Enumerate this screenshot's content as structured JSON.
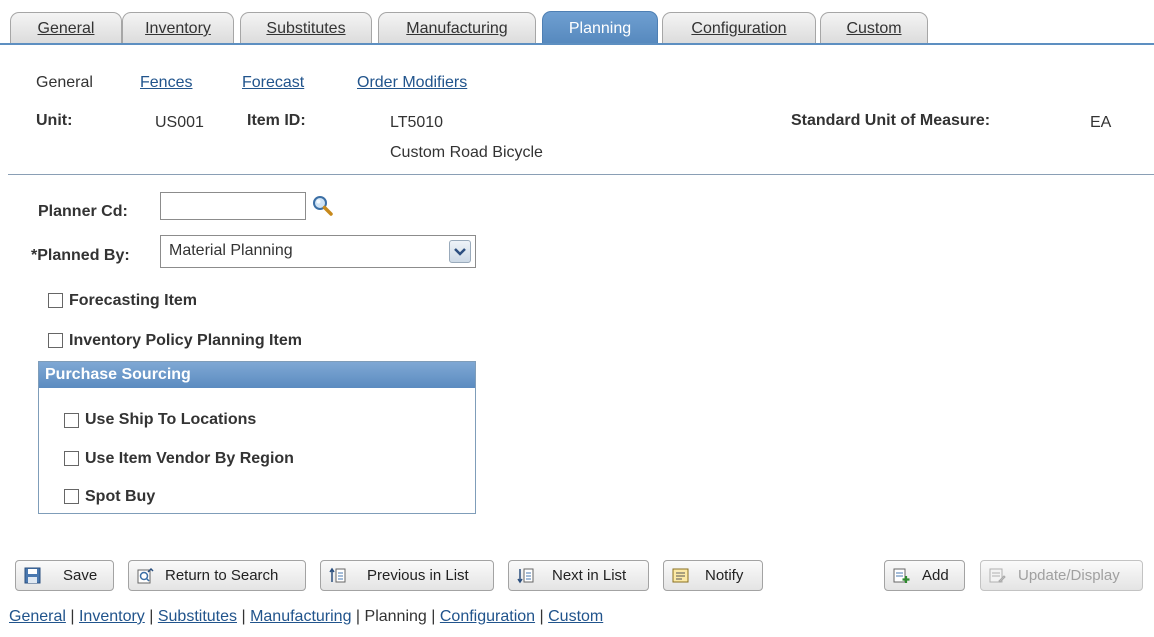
{
  "tabs": [
    {
      "label": "General",
      "active": false
    },
    {
      "label": "Inventory",
      "active": false
    },
    {
      "label": "Substitutes",
      "active": false
    },
    {
      "label": "Manufacturing",
      "active": false
    },
    {
      "label": "Planning",
      "active": true
    },
    {
      "label": "Configuration",
      "active": false
    },
    {
      "label": "Custom",
      "active": false
    }
  ],
  "subnav": {
    "current": "General",
    "links": [
      "Fences",
      "Forecast",
      "Order Modifiers"
    ]
  },
  "header": {
    "unit_label": "Unit:",
    "unit_value": "US001",
    "item_label": "Item ID:",
    "item_value": "LT5010",
    "item_desc": "Custom Road Bicycle",
    "uom_label": "Standard Unit of Measure:",
    "uom_value": "EA"
  },
  "form": {
    "planner_label": "Planner Cd:",
    "planner_value": "",
    "planned_by_label": "*Planned By:",
    "planned_by_value": "Material Planning",
    "forecasting_label": "Forecasting Item",
    "inventory_policy_label": "Inventory Policy Planning Item"
  },
  "purchase_sourcing": {
    "title": "Purchase Sourcing",
    "use_ship_to": "Use Ship To Locations",
    "use_item_vendor": "Use Item Vendor By Region",
    "spot_buy": "Spot Buy"
  },
  "toolbar": {
    "save": "Save",
    "return_to_search": "Return to Search",
    "previous_in_list": "Previous in List",
    "next_in_list": "Next in List",
    "notify": "Notify",
    "add": "Add",
    "update_display": "Update/Display"
  },
  "footer_links": [
    "General",
    "Inventory",
    "Substitutes",
    "Manufacturing",
    "Planning",
    "Configuration",
    "Custom"
  ],
  "colors": {
    "accent": "#5d8fc1",
    "link": "#21548c"
  }
}
